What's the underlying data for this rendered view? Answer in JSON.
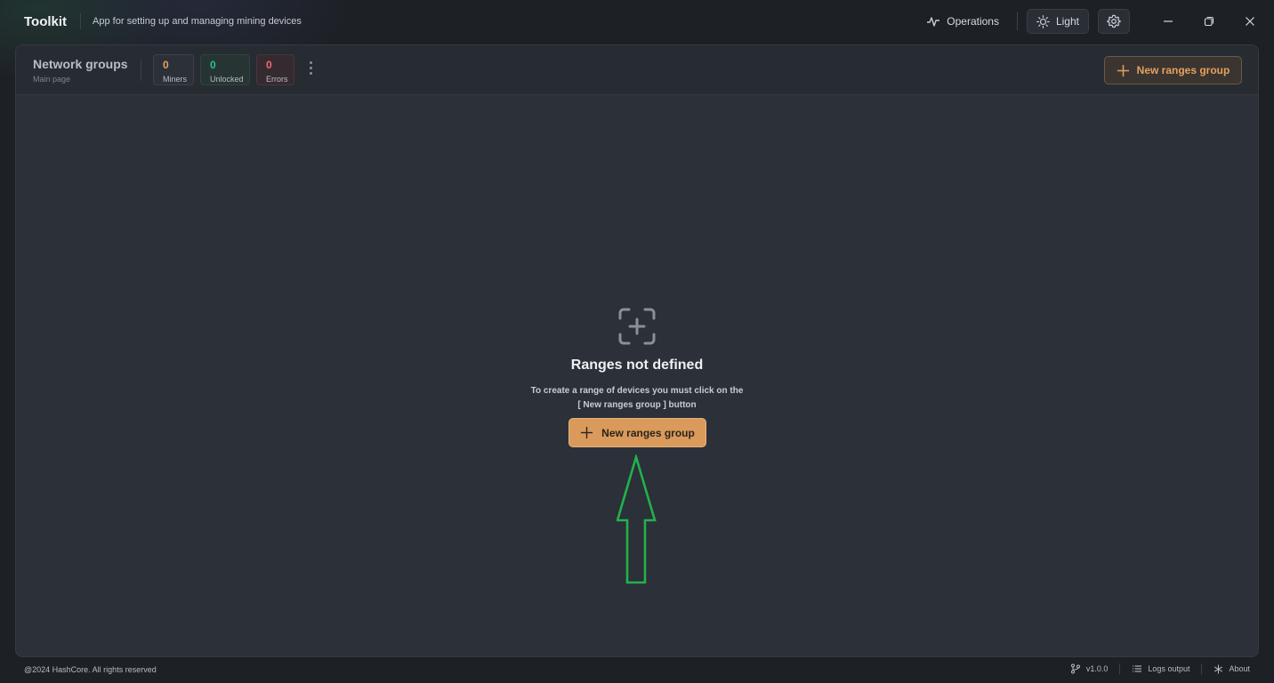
{
  "app": {
    "name": "Toolkit",
    "subtitle": "App for setting up and managing mining devices"
  },
  "titlebar": {
    "operations_label": "Operations",
    "theme_label": "Light",
    "icons": [
      "activity-icon",
      "sun-icon",
      "gear-icon",
      "minimize-icon",
      "restore-icon",
      "close-icon"
    ]
  },
  "header": {
    "title": "Network groups",
    "subtitle": "Main page",
    "stats": {
      "miners": {
        "value": "0",
        "label": "Miners",
        "color": "#e6a05e"
      },
      "unlocked": {
        "value": "0",
        "label": "Unlocked",
        "color": "#22c38e"
      },
      "errors": {
        "value": "0",
        "label": "Errors",
        "color": "#f06a76"
      }
    },
    "new_group_label": "New ranges group"
  },
  "empty_state": {
    "title": "Ranges not defined",
    "description": "To create a range of devices you must click on the [ New ranges group ] button",
    "button_label": "New ranges group"
  },
  "footer": {
    "copyright": "@2024 HashCore. All rights reserved",
    "version": "v1.0.0",
    "logs_label": "Logs output",
    "about_label": "About"
  },
  "colors": {
    "accent": "#d99a5b",
    "background": "#1d2025",
    "panel": "#2b3039",
    "annotation_arrow": "#22b14c"
  }
}
